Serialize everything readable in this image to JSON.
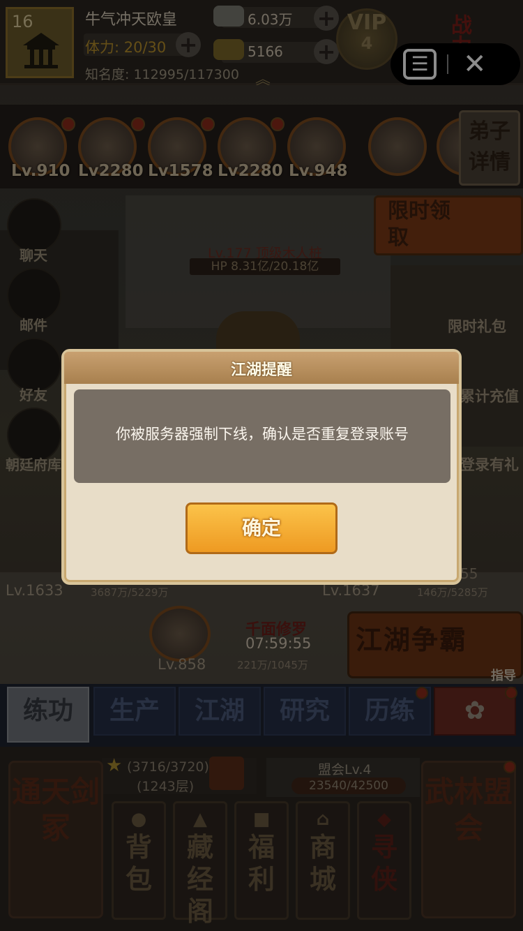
{
  "player": {
    "level": "16",
    "name": "牛气冲天欧皇",
    "stamina": "体力: 20/30",
    "fame": "知名度: 112995/117300"
  },
  "resources": {
    "silver": "6.03万",
    "gold": "5166"
  },
  "vip": {
    "label": "VIP",
    "level": "4"
  },
  "power_label": "战力",
  "capsule": {
    "menu_icon": "menu-icon",
    "close_icon": "close-icon"
  },
  "heroes": [
    {
      "level": "Lv.910"
    },
    {
      "level": "Lv2280"
    },
    {
      "level": "Lv1578"
    },
    {
      "level": "Lv2280"
    },
    {
      "level": "Lv.948"
    },
    {
      "level": ""
    },
    {
      "level": ""
    }
  ],
  "disciple_button": "弟子详情",
  "limited_banner": "限时领取",
  "side_left": [
    {
      "label": "聊天",
      "icon": "chat-icon"
    },
    {
      "label": "邮件",
      "icon": "mail-icon"
    },
    {
      "label": "好友",
      "icon": "friend-icon"
    },
    {
      "label": "朝廷府库",
      "icon": "treasury-icon"
    }
  ],
  "side_right": [
    "限时礼包",
    "累计充值",
    "登录有礼"
  ],
  "boss": {
    "name": "Lv.177 顶级木人桩",
    "hp": "HP 8.31亿/20.18亿"
  },
  "units": {
    "left": {
      "level": "Lv.1633",
      "hp": "3687万/5229万"
    },
    "right": {
      "level": "Lv.1637",
      "hp": "146万/5285万",
      "timer": "55"
    },
    "center": {
      "name": "千面修罗",
      "timer": "07:59:55",
      "level": "Lv.858",
      "hp": "221万/1045万"
    }
  },
  "arena_banner": "江湖争霸",
  "guide_label": "指导",
  "tabs": [
    "练功",
    "生产",
    "江湖",
    "研究",
    "历练",
    "✿"
  ],
  "tower": {
    "progress": "(3716/3720)",
    "floor": "(1243层)"
  },
  "alliance": {
    "level": "盟会Lv.4",
    "exp": "23540/42500"
  },
  "big_left_button": "通天剑冢",
  "big_right_button": "武林盟会",
  "small_buttons": [
    {
      "label": "背包",
      "icon": "bag-icon"
    },
    {
      "label": "藏经阁",
      "icon": "pagoda-icon"
    },
    {
      "label": "福利",
      "icon": "chest-icon"
    },
    {
      "label": "商城",
      "icon": "shop-icon"
    },
    {
      "label": "寻侠",
      "icon": "seek-icon"
    }
  ],
  "dialog": {
    "title": "江湖提醒",
    "message": "你被服务器强制下线，确认是否重复登录账号",
    "confirm": "确定"
  }
}
